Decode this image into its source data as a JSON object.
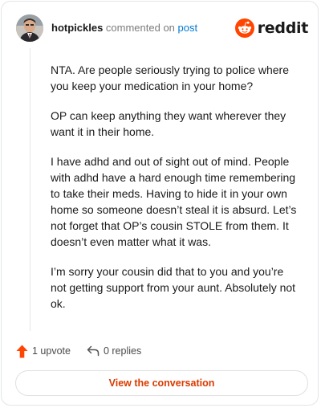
{
  "header": {
    "username": "hotpickles",
    "action_text": "commented on",
    "post_link": "post",
    "brand": "reddit"
  },
  "comment": {
    "paragraphs": [
      "NTA. Are people seriously trying to police where you keep your medication in your home?",
      "OP can keep anything they want wherever they want it in their home.",
      "I have adhd and out of sight out of mind. People with adhd have a hard enough time remembering to take their meds. Having to hide it in your own home so someone doesn’t steal it is absurd. Let’s not forget that OP’s cousin STOLE from them. It doesn’t even matter what it was.",
      "I’m sorry your cousin did that to you and you’re not getting support from your aunt. Absolutely not ok."
    ]
  },
  "actions": {
    "upvote_label": "1 upvote",
    "replies_label": "0 replies"
  },
  "footer": {
    "view_label": "View the conversation"
  },
  "colors": {
    "brand_orange": "#ff4500",
    "link_blue": "#0079d3",
    "button_text": "#d93a00"
  },
  "icons": {
    "upvote": "upvote-arrow-icon",
    "reply": "reply-arrow-icon",
    "brand": "reddit-snoo-icon"
  }
}
